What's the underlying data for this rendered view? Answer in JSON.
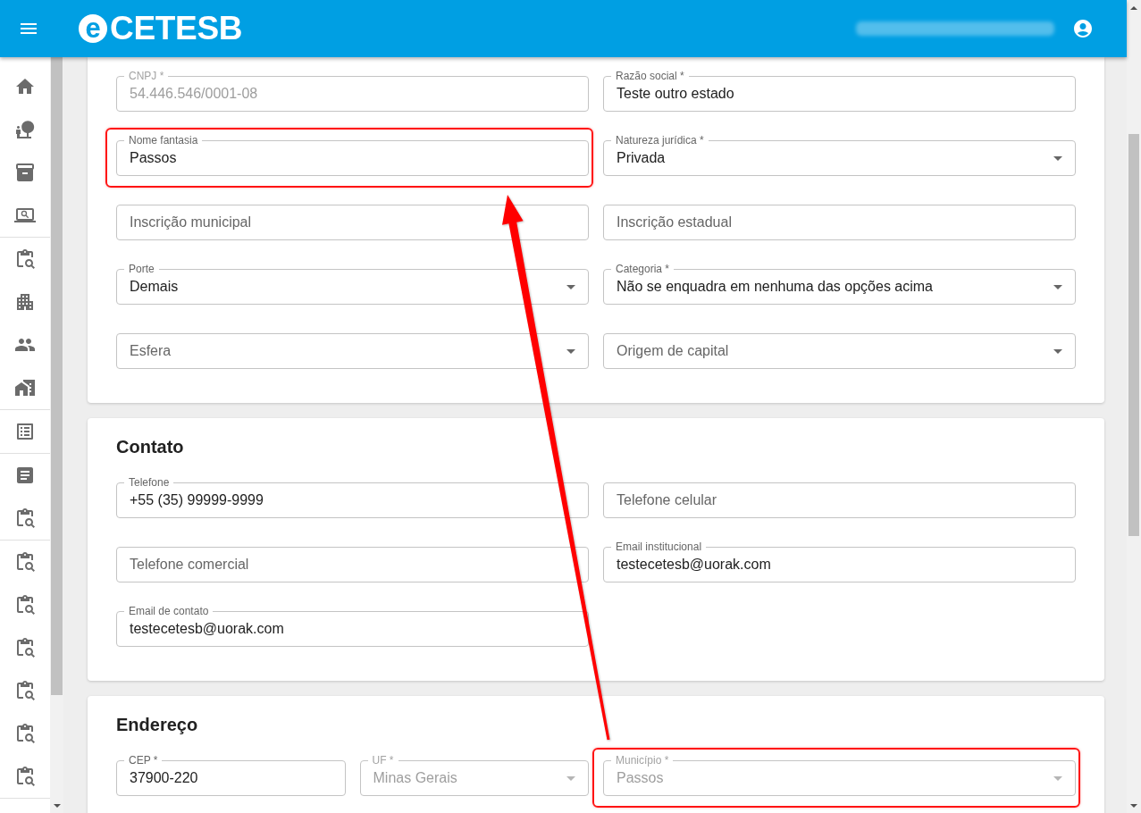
{
  "header": {
    "logo_mark": "e",
    "brand": "CETESB",
    "email_blurred": true
  },
  "sections": [
    {
      "kind": "pairs",
      "fields": [
        {
          "kind": "text",
          "label": "CNPJ *",
          "value": "54.446.546/0001-08",
          "disabled": true,
          "highlighted": false
        },
        {
          "kind": "text",
          "label": "Razão social *",
          "value": "Teste outro estado",
          "disabled": false,
          "highlighted": false
        },
        {
          "kind": "text",
          "label": "Nome fantasia",
          "value": "Passos",
          "disabled": false,
          "highlighted": true
        },
        {
          "kind": "select",
          "label": "Natureza jurídica *",
          "value": "Privada",
          "disabled": false,
          "highlighted": false
        },
        {
          "kind": "text",
          "placeholder": "Inscrição municipal",
          "disabled": false,
          "highlighted": false
        },
        {
          "kind": "text",
          "placeholder": "Inscrição estadual",
          "disabled": false,
          "highlighted": false
        },
        {
          "kind": "select",
          "label": "Porte",
          "value": "Demais",
          "disabled": false,
          "highlighted": false
        },
        {
          "kind": "select",
          "label": "Categoria *",
          "value": "Não se enquadra em nenhuma das opções acima",
          "disabled": false,
          "highlighted": false
        },
        {
          "kind": "select",
          "placeholder": "Esfera",
          "disabled": false,
          "highlighted": false
        },
        {
          "kind": "select",
          "placeholder": "Origem de capital",
          "disabled": false,
          "highlighted": false
        }
      ]
    },
    {
      "kind": "pairs",
      "title": "Contato",
      "fields": [
        {
          "kind": "text",
          "label": "Telefone",
          "value": "+55 (35) 99999-9999",
          "disabled": false,
          "highlighted": false
        },
        {
          "kind": "text",
          "placeholder": "Telefone celular",
          "disabled": false,
          "highlighted": false
        },
        {
          "kind": "text",
          "placeholder": "Telefone comercial",
          "disabled": false,
          "highlighted": false
        },
        {
          "kind": "text",
          "label": "Email institucional",
          "value": "testecetesb@uorak.com",
          "disabled": false,
          "highlighted": false
        },
        {
          "kind": "text",
          "label": "Email de contato",
          "value": "testecetesb@uorak.com",
          "disabled": false,
          "highlighted": false
        }
      ]
    },
    {
      "kind": "address",
      "title": "Endereço",
      "fields": [
        {
          "kind": "text",
          "label": "CEP *",
          "value": "37900-220",
          "disabled": false,
          "highlighted": false
        },
        {
          "kind": "select",
          "label": "UF *",
          "value": "Minas Gerais",
          "disabled": true,
          "highlighted": false
        },
        {
          "kind": "select",
          "label": "Município *",
          "value": "Passos",
          "disabled": true,
          "highlighted": true
        }
      ]
    }
  ],
  "annotation_arrow": true
}
